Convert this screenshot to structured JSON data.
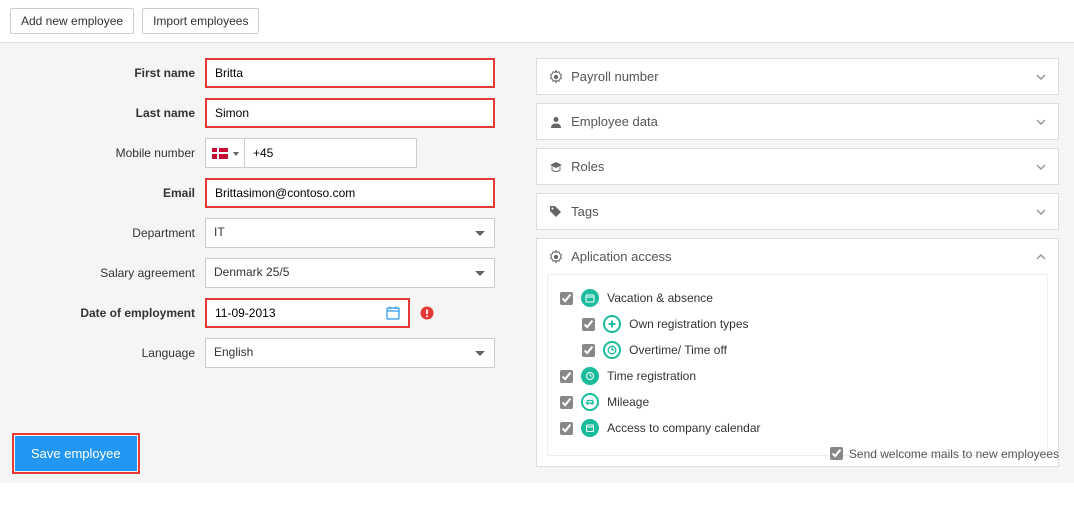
{
  "topbar": {
    "add_label": "Add new employee",
    "import_label": "Import employees"
  },
  "form": {
    "first_name": {
      "label": "First name",
      "value": "Britta"
    },
    "last_name": {
      "label": "Last name",
      "value": "Simon"
    },
    "mobile": {
      "label": "Mobile number",
      "prefix": "+45"
    },
    "email": {
      "label": "Email",
      "value": "Brittasimon@contoso.com"
    },
    "department": {
      "label": "Department",
      "value": "IT"
    },
    "salary": {
      "label": "Salary agreement",
      "value": "Denmark 25/5"
    },
    "doe": {
      "label": "Date of employment",
      "value": "11-09-2013"
    },
    "language": {
      "label": "Language",
      "value": "English"
    }
  },
  "panels": {
    "payroll": "Payroll number",
    "employee_data": "Employee data",
    "roles": "Roles",
    "tags": "Tags",
    "app_access": "Aplication access"
  },
  "access": {
    "vacation": "Vacation & absence",
    "own_reg": "Own registration types",
    "overtime": "Overtime/ Time off",
    "time_reg": "Time registration",
    "mileage": "Mileage",
    "calendar": "Access to company calendar"
  },
  "footer": {
    "save": "Save employee",
    "welcome": "Send welcome mails to new employees"
  }
}
